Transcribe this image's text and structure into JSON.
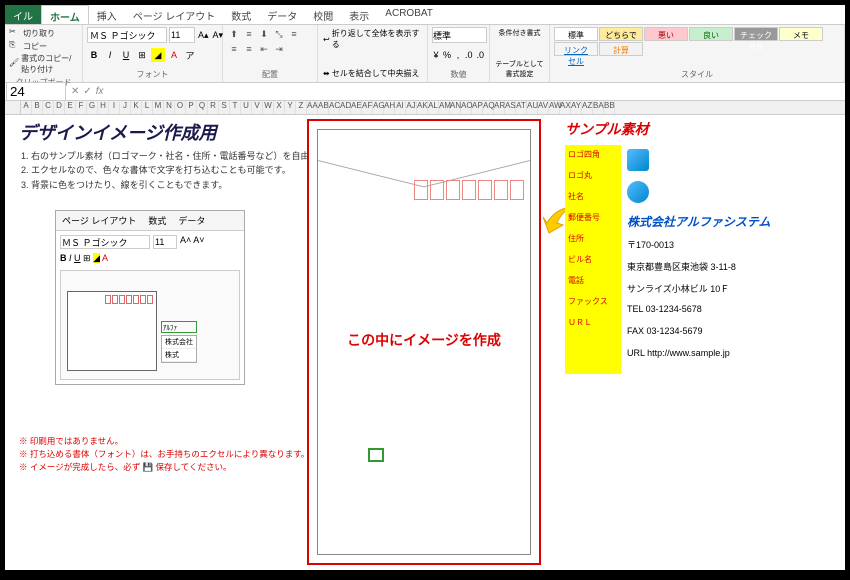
{
  "tabs": {
    "file": "イル",
    "home": "ホーム",
    "insert": "挿入",
    "layout": "ページ レイアウト",
    "formula": "数式",
    "data": "データ",
    "review": "校閲",
    "view": "表示",
    "acrobat": "ACROBAT"
  },
  "clipboard": {
    "cut": "切り取り",
    "copy": "コピー",
    "paste": "書式のコピー/貼り付け",
    "label": "クリップボード"
  },
  "font": {
    "name": "ＭＳ Ｐゴシック",
    "size": "11",
    "label": "フォント"
  },
  "align": {
    "wrap": "折り返して全体を表示する",
    "merge": "セルを結合して中央揃え",
    "label": "配置"
  },
  "number": {
    "format": "標準",
    "label": "数値"
  },
  "styles": {
    "cond": "条件付き書式",
    "table": "テーブルとして書式設定",
    "label": "スタイル",
    "g": {
      "std": "標準",
      "neutral": "どちらでもない",
      "bad": "悪い",
      "good": "良い",
      "check": "チェック セル",
      "memo": "メモ",
      "link": "リンク セル",
      "calc": "計算"
    }
  },
  "nameBox": "24",
  "cols": [
    "A",
    "B",
    "C",
    "D",
    "E",
    "F",
    "G",
    "H",
    "I",
    "J",
    "K",
    "L",
    "M",
    "N",
    "O",
    "P",
    "Q",
    "R",
    "S",
    "T",
    "U",
    "V",
    "W",
    "X",
    "Y",
    "Z",
    "AA",
    "AB",
    "AC",
    "AD",
    "AE",
    "AF",
    "AG",
    "AH",
    "AI",
    "AJ",
    "AK",
    "AL",
    "AM",
    "AN",
    "AO",
    "AP",
    "AQ",
    "AR",
    "AS",
    "AT",
    "AU",
    "AV",
    "AW",
    "AX",
    "AY",
    "AZ",
    "BA",
    "BB"
  ],
  "title": "デザインイメージ作成用",
  "instructions": [
    "右のサンプル素材（ロゴマーク・社名・住所・電話番号など）を自由に配置して、画面上で全体のイメージを作成できます。",
    "エクセルなので、色々な書体で文字を打ち込むことも可能です。",
    "背景に色をつけたり、線を引くこともできます。"
  ],
  "embed": {
    "tabs": [
      "ページ レイアウト",
      "数式",
      "データ"
    ],
    "font": "ＭＳ Ｐゴシック",
    "size": "11",
    "cell": "ｱﾙﾌｧ",
    "list": [
      "株式会社",
      "株式"
    ]
  },
  "warnings": [
    "※ 印刷用ではありません。",
    "※ 打ち込める書体（フォント）は、お手持ちのエクセルにより異なります。",
    "※ イメージが完成したら、必ず 💾 保存してください。"
  ],
  "envelope": {
    "msg": "この中にイメージを作成"
  },
  "sample": {
    "title": "サンプル素材",
    "labels": {
      "logoSq": "ロゴ四角",
      "logoCir": "ロゴ丸",
      "company": "社名",
      "postal": "郵便番号",
      "addr": "住所",
      "bldg": "ビル名",
      "tel": "電話",
      "fax": "ファックス",
      "url": "ＵＲＬ"
    },
    "vals": {
      "company": "株式会社アルファシステム",
      "postal": "〒170-0013",
      "addr": "東京都豊島区東池袋 3-11-8",
      "bldg": "サンライズ小林ビル 10Ｆ",
      "tel": "TEL 03-1234-5678",
      "fax": "FAX 03-1234-5679",
      "url": "URL http://www.sample.jp"
    }
  }
}
